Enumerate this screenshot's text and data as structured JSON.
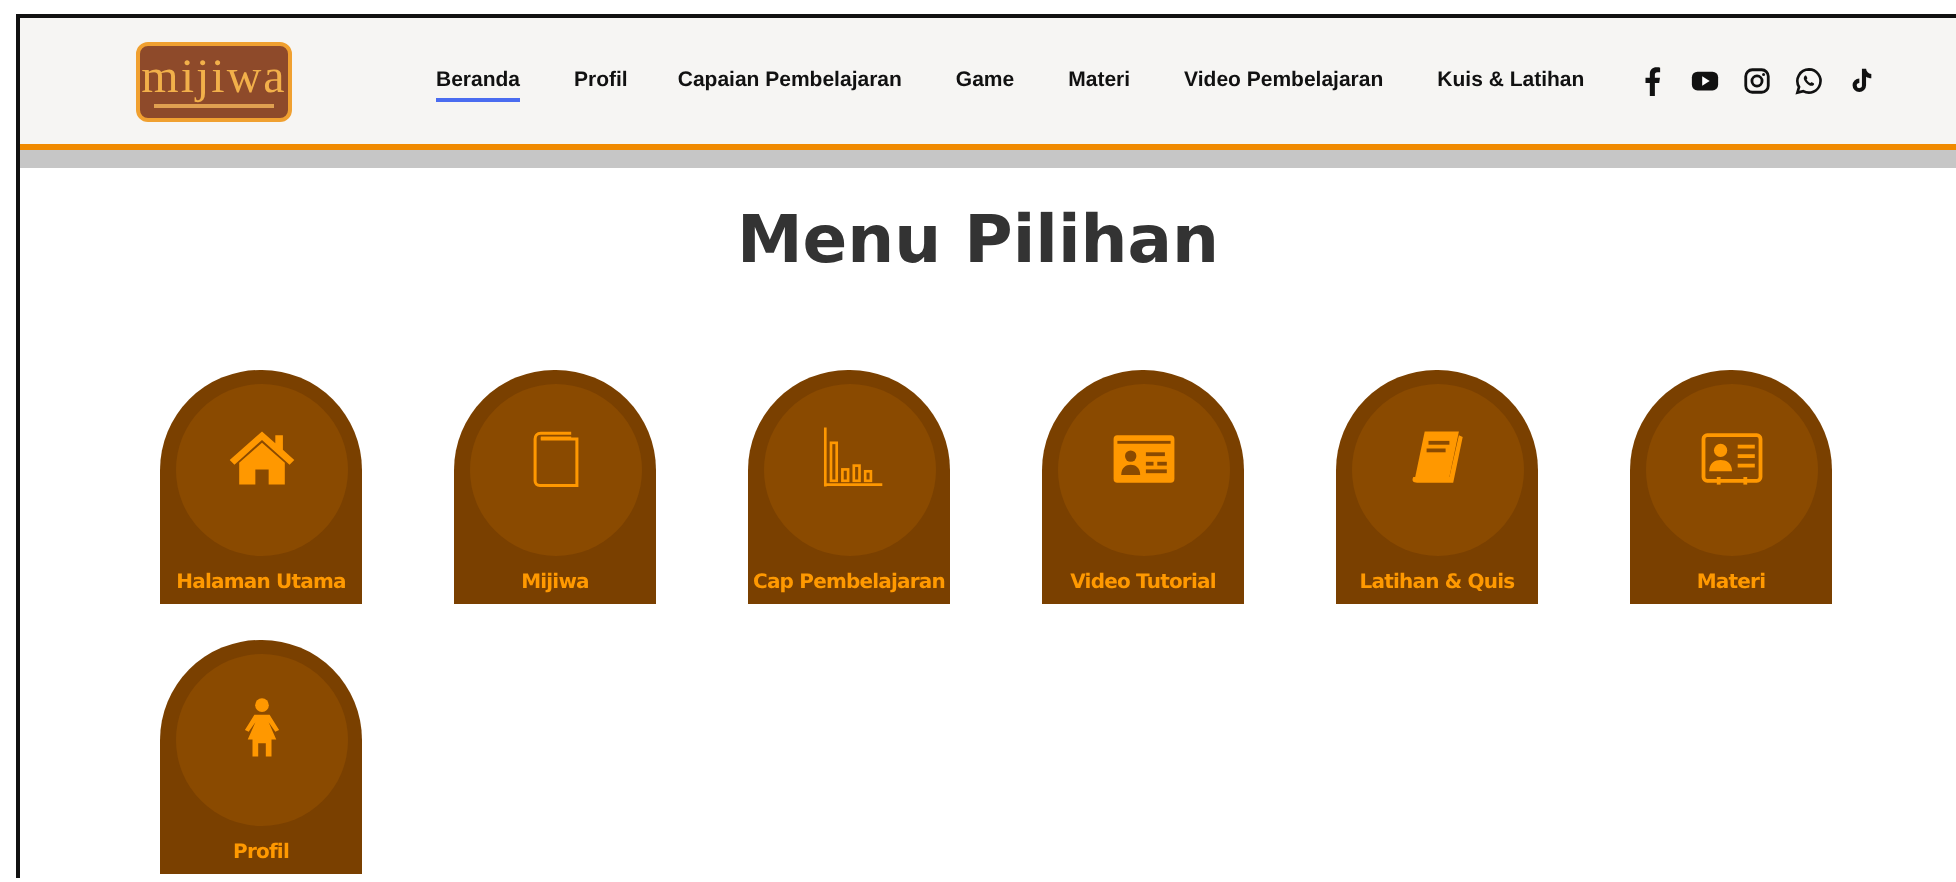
{
  "logo": {
    "text": "mijiwa"
  },
  "nav": [
    {
      "label": "Beranda",
      "selected": true
    },
    {
      "label": "Profil",
      "selected": false
    },
    {
      "label": "Capaian Pembelajaran",
      "selected": false
    },
    {
      "label": "Game",
      "selected": false
    },
    {
      "label": "Materi",
      "selected": false
    },
    {
      "label": "Video Pembelajaran",
      "selected": false
    },
    {
      "label": "Kuis & Latihan",
      "selected": false
    }
  ],
  "social": [
    {
      "kind": "facebook"
    },
    {
      "kind": "youtube"
    },
    {
      "kind": "instagram"
    },
    {
      "kind": "whatsapp"
    },
    {
      "kind": "tiktok"
    }
  ],
  "heading": "Menu Pilihan",
  "menu": [
    {
      "label": "Halaman Utama",
      "kind": "home"
    },
    {
      "label": "Mijiwa",
      "kind": "book"
    },
    {
      "label": "Cap Pembelajaran",
      "kind": "chart"
    },
    {
      "label": "Video Tutorial",
      "kind": "idcard"
    },
    {
      "label": "Latihan & Quis",
      "kind": "notebook"
    },
    {
      "label": "Materi",
      "kind": "contact"
    },
    {
      "label": "Profil",
      "kind": "person"
    }
  ]
}
